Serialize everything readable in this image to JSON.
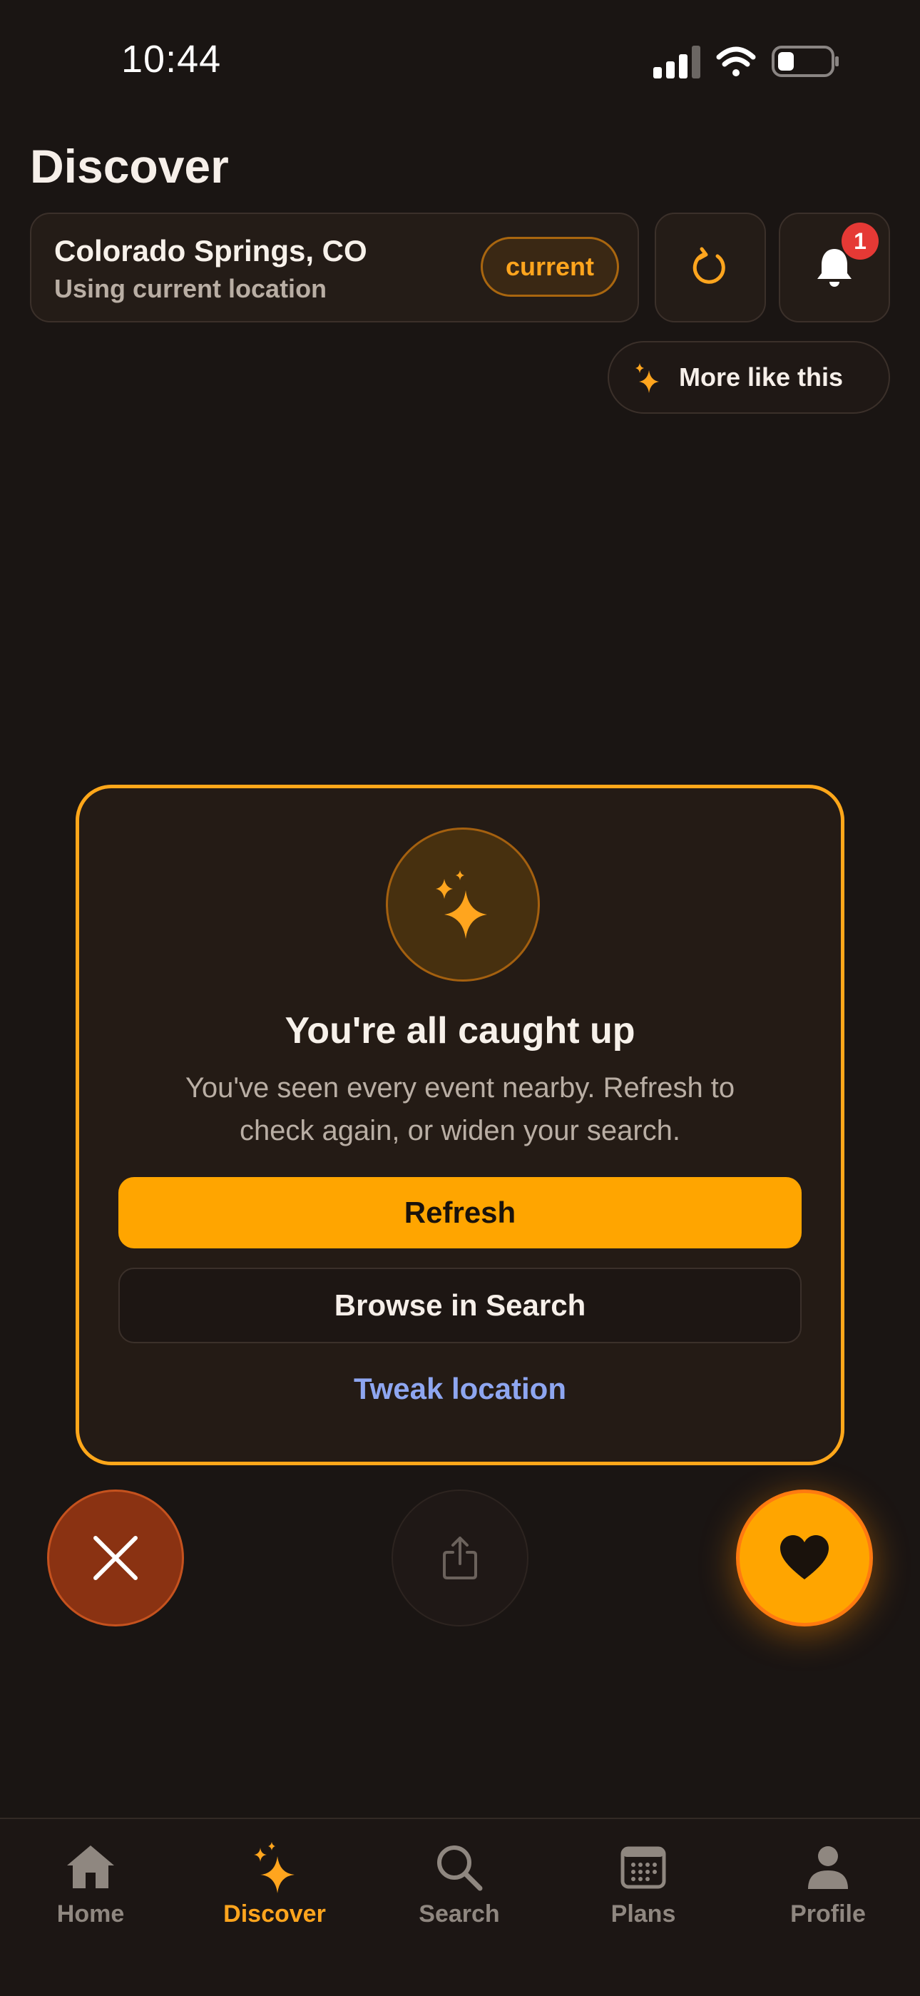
{
  "status_bar": {
    "time": "10:44"
  },
  "header": {
    "title": "Discover"
  },
  "location": {
    "name": "Colorado Springs, CO",
    "subtitle": "Using current location",
    "badge": "current"
  },
  "notifications": {
    "count": "1"
  },
  "more_like_this": {
    "label": "More like this"
  },
  "empty_state": {
    "title": "You're all caught up",
    "description": "You've seen every event nearby. Refresh to check again, or widen your search.",
    "refresh_label": "Refresh",
    "browse_label": "Browse in Search",
    "tweak_label": "Tweak location"
  },
  "tabs": [
    {
      "label": "Home",
      "icon": "home-icon"
    },
    {
      "label": "Discover",
      "icon": "sparkles-icon",
      "active": true
    },
    {
      "label": "Search",
      "icon": "search-icon"
    },
    {
      "label": "Plans",
      "icon": "calendar-icon"
    },
    {
      "label": "Profile",
      "icon": "person-icon"
    }
  ],
  "colors": {
    "background": "#1a1513",
    "accent": "#ffa500",
    "link": "#8ea6f0",
    "dismiss": "#8a3212",
    "badge": "#e53935"
  }
}
